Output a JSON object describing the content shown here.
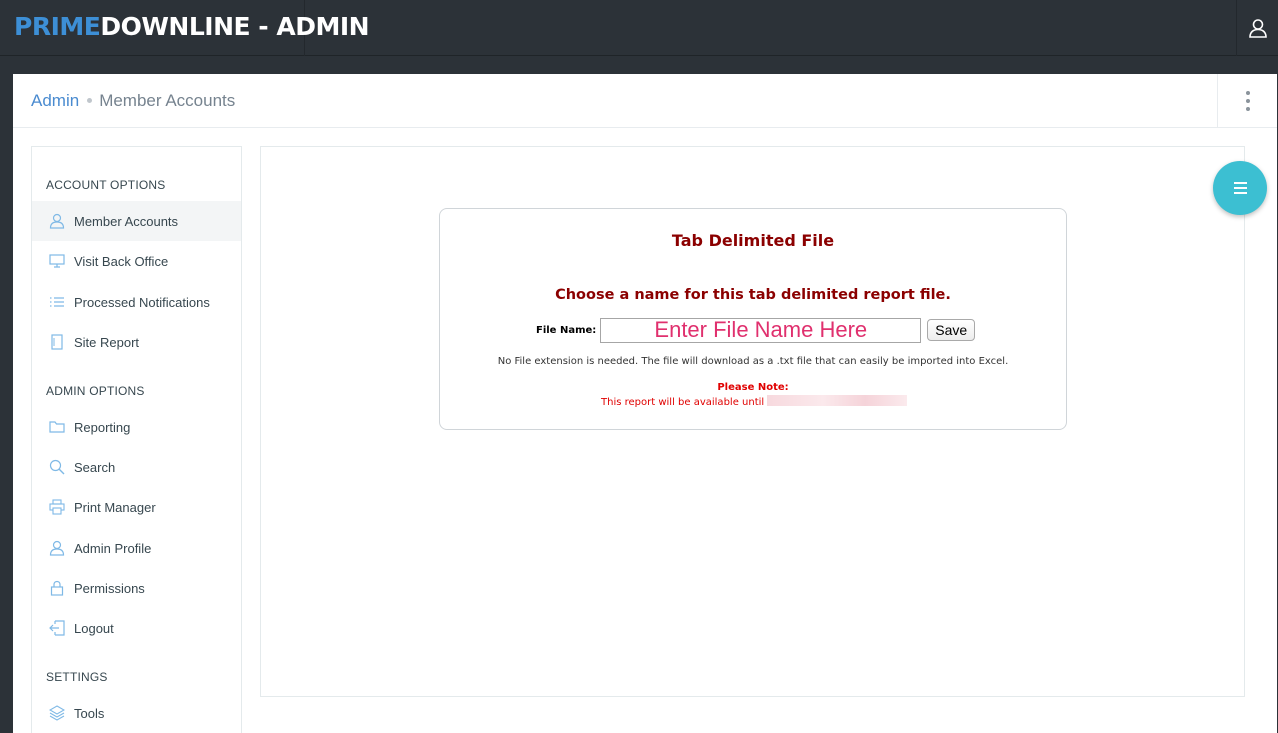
{
  "header": {
    "brand_part1": "PRIME",
    "brand_part2": "DOWNLINE - ADMIN",
    "user_icon": "user-icon"
  },
  "breadcrumb": {
    "root": "Admin",
    "current": "Member Accounts"
  },
  "sidebar": {
    "sections": [
      {
        "title": "ACCOUNT OPTIONS",
        "items": [
          {
            "label": "Member Accounts",
            "icon": "user-icon",
            "active": true
          },
          {
            "label": "Visit Back Office",
            "icon": "monitor-icon"
          },
          {
            "label": "Processed Notifications",
            "icon": "list-icon"
          },
          {
            "label": "Site Report",
            "icon": "document-icon"
          }
        ]
      },
      {
        "title": "ADMIN OPTIONS",
        "items": [
          {
            "label": "Reporting",
            "icon": "folder-icon"
          },
          {
            "label": "Search",
            "icon": "search-icon"
          },
          {
            "label": "Print Manager",
            "icon": "printer-icon"
          },
          {
            "label": "Admin Profile",
            "icon": "user-icon"
          },
          {
            "label": "Permissions",
            "icon": "lock-icon"
          },
          {
            "label": "Logout",
            "icon": "logout-icon"
          }
        ]
      },
      {
        "title": "SETTINGS",
        "items": [
          {
            "label": "Tools",
            "icon": "layers-icon"
          }
        ]
      }
    ]
  },
  "card": {
    "title": "Tab Delimited File",
    "subtitle": "Choose a name for this tab delimited report file.",
    "file_label": "File Name:",
    "file_placeholder": "Enter File Name Here",
    "save_label": "Save",
    "hint": "No File extension is needed. The file will download as a .txt file that can easily be imported into Excel.",
    "note_heading": "Please Note:",
    "note_text": "This report will be available until"
  },
  "colors": {
    "topbar": "#2c3238",
    "brand_accent": "#3d8fd6",
    "accent": "#3cbfd2",
    "card_title": "#8b0000",
    "note": "#e00000",
    "input_text": "#e0306e"
  },
  "fab": {
    "icon": "menu-icon"
  }
}
